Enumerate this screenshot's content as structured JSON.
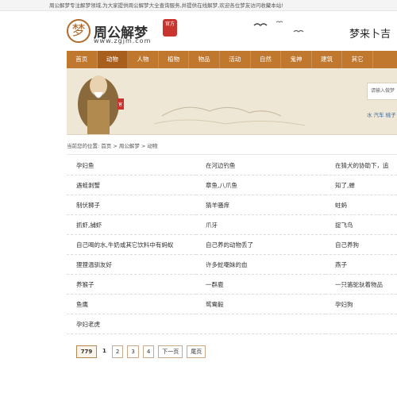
{
  "topbar": {
    "notice": "周公解梦专注解梦领域,为大家提供周公解梦大全查询服务,并提供在线解梦,欢迎各位梦友访问收藏本站!"
  },
  "header": {
    "logo_char": "梦",
    "logo_text": "周公解梦",
    "logo_seal": "官方",
    "logo_sub": "www.zgjm.com",
    "slogan": "梦来卜吉"
  },
  "nav": {
    "items": [
      {
        "label": "首页"
      },
      {
        "label": "动物"
      },
      {
        "label": "人物"
      },
      {
        "label": "植物"
      },
      {
        "label": "物品"
      },
      {
        "label": "活动"
      },
      {
        "label": "自然"
      },
      {
        "label": "鬼神"
      },
      {
        "label": "建筑"
      },
      {
        "label": "其它"
      }
    ],
    "active_index": 1
  },
  "banner": {
    "search_placeholder": "请输入做梦",
    "hot_words": "水 汽车 桃子"
  },
  "breadcrumb": {
    "prefix": "当前您的位置:",
    "home": "首页",
    "sep1": ">",
    "section": "周公解梦",
    "sep2": ">",
    "current": "动物"
  },
  "list": {
    "rows": [
      [
        "孕妇鱼",
        "在河边钓鱼",
        "在猜犬的协助下，追"
      ],
      [
        "遇蛙剥蟹",
        "章鱼,八爪鱼",
        "知了,蝉"
      ],
      [
        "制伏狮子",
        "猜羊骚痒",
        "蛀蚂"
      ],
      [
        "抓虾,捕虾",
        "爪牙",
        "捉飞鸟"
      ],
      [
        "自己喝的水,牛奶或其它饮料中有蚂蚁",
        "自己养的动物丢了",
        "自己养狗"
      ],
      [
        "狸狸温驯友好",
        "许多蛇嘲妹的血",
        "燕子"
      ],
      [
        "养猴子",
        "一群鹿",
        "一只骆驼驮着物品"
      ],
      [
        "鱼鹰",
        "鸳鸯毅",
        "孕妇狗"
      ],
      [
        "孕妇老虎",
        "",
        ""
      ]
    ]
  },
  "pager": {
    "total": "779",
    "current": "1",
    "pages": [
      "2",
      "3",
      "4"
    ],
    "next": "下一页",
    "last": "尾页"
  }
}
